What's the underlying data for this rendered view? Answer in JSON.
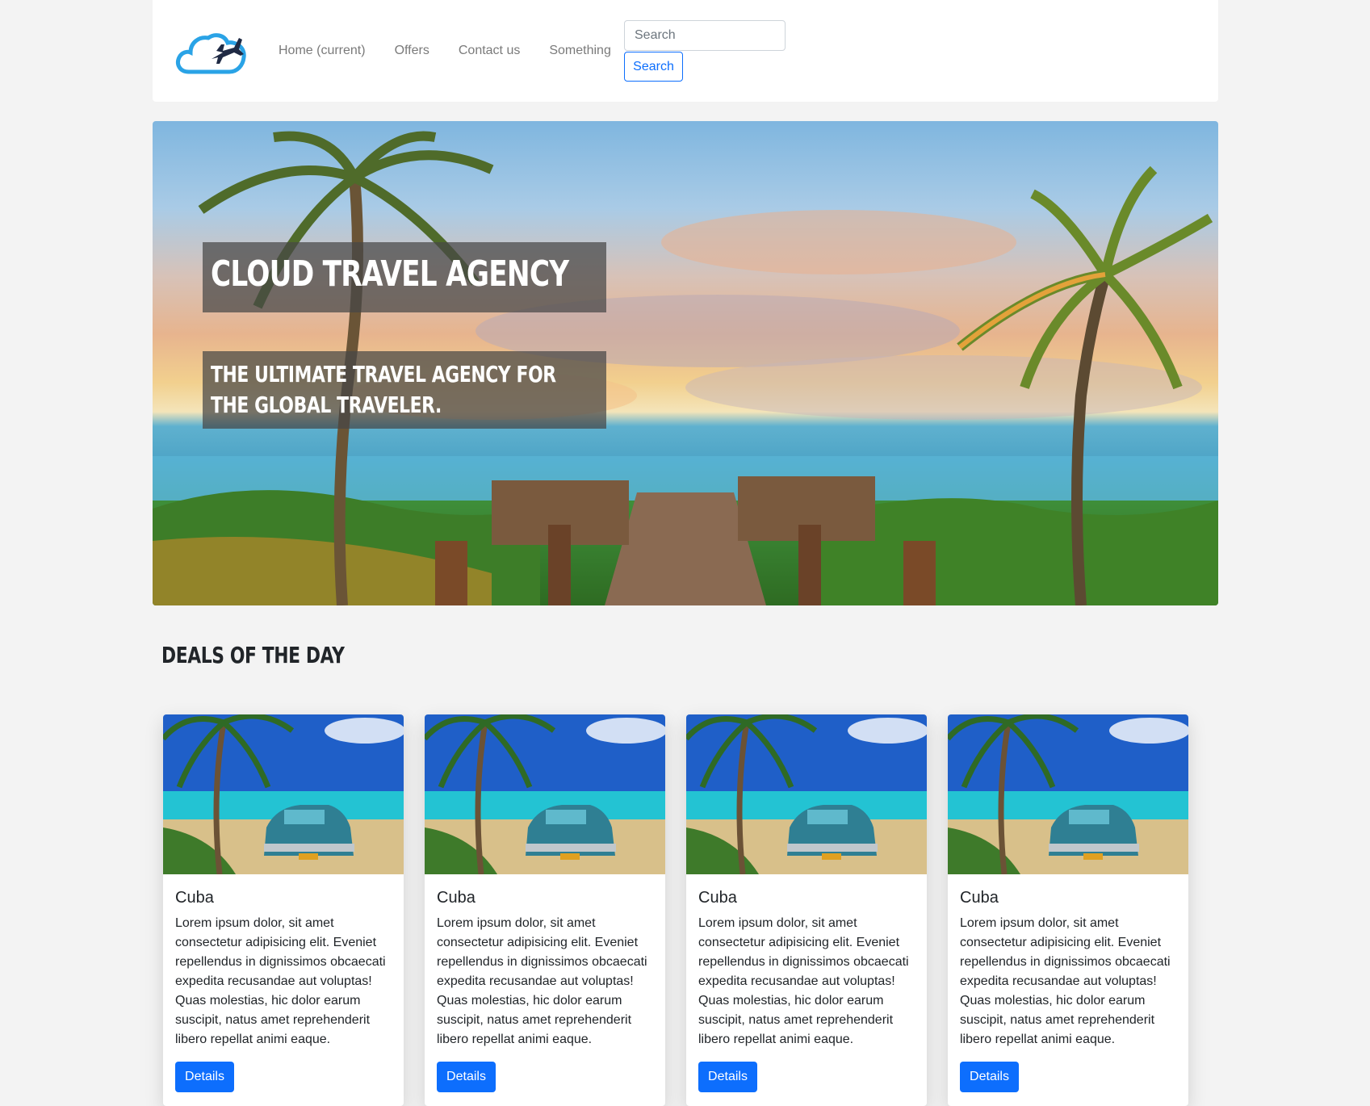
{
  "nav": {
    "links": [
      "Home (current)",
      "Offers",
      "Contact us",
      "Something"
    ],
    "search_placeholder": "Search",
    "search_button": "Search"
  },
  "hero": {
    "title": "CLOUD TRAVEL AGENCY",
    "subtitle": "THE ULTIMATE TRAVEL AGENCY FOR THE GLOBAL TRAVELER."
  },
  "deals": {
    "heading": "DEALS OF THE DAY",
    "cards": [
      {
        "title": "Cuba",
        "text": "Lorem ipsum dolor, sit amet consectetur adipisicing elit. Eveniet repellendus in dignissimos obcaecati expedita recusandae aut voluptas! Quas molestias, hic dolor earum suscipit, natus amet reprehenderit libero repellat animi eaque.",
        "button": "Details"
      },
      {
        "title": "Cuba",
        "text": "Lorem ipsum dolor, sit amet consectetur adipisicing elit. Eveniet repellendus in dignissimos obcaecati expedita recusandae aut voluptas! Quas molestias, hic dolor earum suscipit, natus amet reprehenderit libero repellat animi eaque.",
        "button": "Details"
      },
      {
        "title": "Cuba",
        "text": "Lorem ipsum dolor, sit amet consectetur adipisicing elit. Eveniet repellendus in dignissimos obcaecati expedita recusandae aut voluptas! Quas molestias, hic dolor earum suscipit, natus amet reprehenderit libero repellat animi eaque.",
        "button": "Details"
      },
      {
        "title": "Cuba",
        "text": "Lorem ipsum dolor, sit amet consectetur adipisicing elit. Eveniet repellendus in dignissimos obcaecati expedita recusandae aut voluptas! Quas molestias, hic dolor earum suscipit, natus amet reprehenderit libero repellat animi eaque.",
        "button": "Details"
      }
    ]
  },
  "colors": {
    "primary": "#0d6efd",
    "logo_blue": "#2aa3e6",
    "page_bg": "#f3f3f3"
  },
  "icons": {
    "logo": "cloud-airplane-logo"
  }
}
